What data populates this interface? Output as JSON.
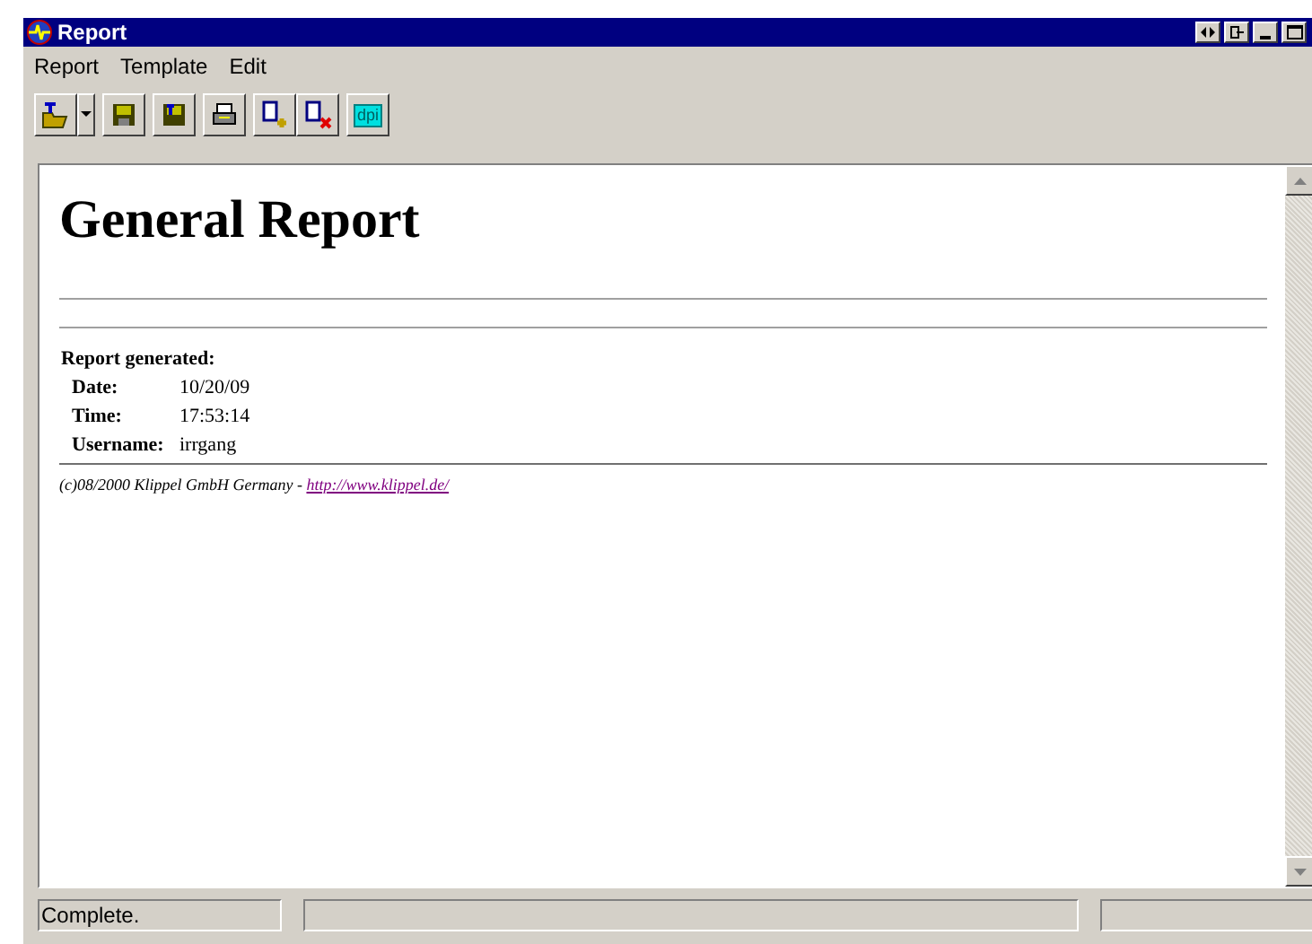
{
  "window": {
    "title": "Report"
  },
  "menu": [
    "Report",
    "Template",
    "Edit"
  ],
  "toolbar": {
    "dpi_label": "dpi"
  },
  "report": {
    "heading": "General Report",
    "generated_label": "Report generated:",
    "rows": [
      {
        "label": "Date:",
        "value": "10/20/09"
      },
      {
        "label": "Time:",
        "value": "17:53:14"
      },
      {
        "label": "Username:",
        "value": "irrgang"
      }
    ],
    "footer": "(c)08/2000 Klippel GmbH Germany - ",
    "link": "http://www.klippel.de/"
  },
  "status_bar": {
    "message": "Complete."
  }
}
